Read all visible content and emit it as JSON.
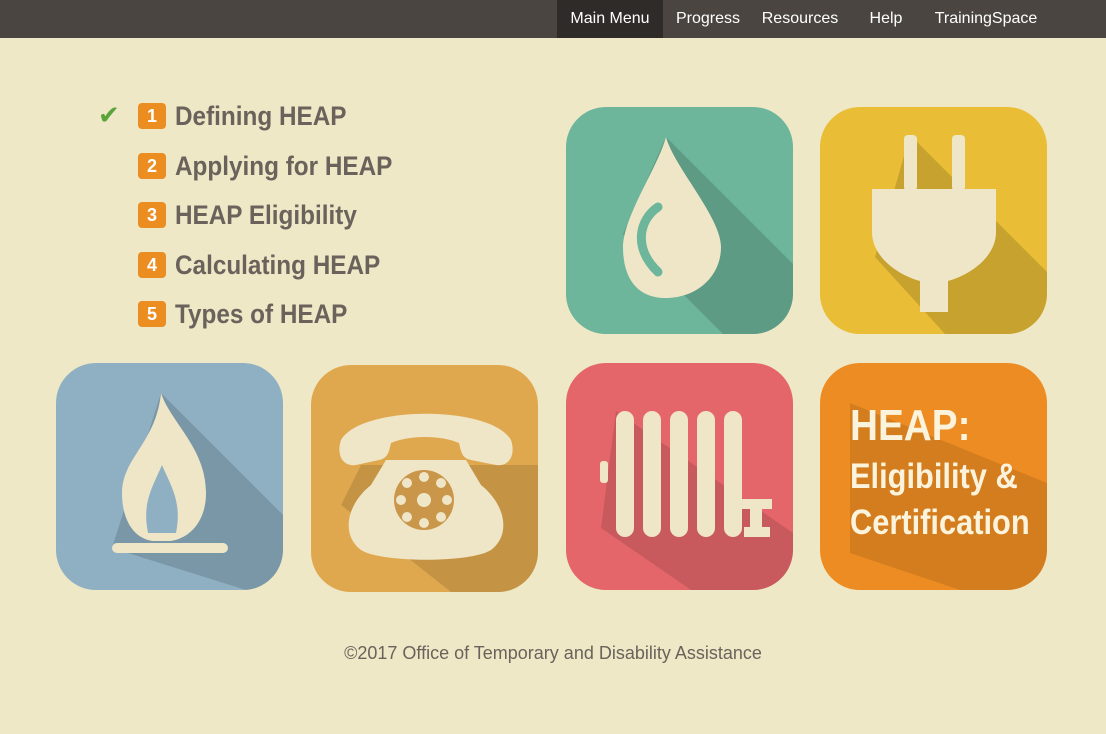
{
  "nav": {
    "items": [
      {
        "label": "Main Menu"
      },
      {
        "label": "Progress"
      },
      {
        "label": "Resources"
      },
      {
        "label": "Help"
      },
      {
        "label": "TrainingSpace"
      }
    ]
  },
  "menu": {
    "items": [
      {
        "number": "1",
        "label": "Defining HEAP",
        "completed": true
      },
      {
        "number": "2",
        "label": "Applying for HEAP",
        "completed": false
      },
      {
        "number": "3",
        "label": "HEAP Eligibility",
        "completed": false
      },
      {
        "number": "4",
        "label": "Calculating HEAP",
        "completed": false
      },
      {
        "number": "5",
        "label": "Types of HEAP",
        "completed": false
      }
    ],
    "check_glyph": "✔"
  },
  "tiles": [
    {
      "icon": "water-drop-icon",
      "color": "#6db59b"
    },
    {
      "icon": "electric-plug-icon",
      "color": "#e9bd36"
    },
    {
      "icon": "gas-flame-icon",
      "color": "#8fb0c3"
    },
    {
      "icon": "rotary-phone-icon",
      "color": "#e0a84e"
    },
    {
      "icon": "radiator-icon",
      "color": "#e4666a"
    }
  ],
  "title_tile": {
    "line1": "HEAP:",
    "line2": "Eligibility &",
    "line3": "Certification",
    "color": "#ec8c22"
  },
  "footer": {
    "text": "©2017 Office of Temporary and Disability Assistance"
  },
  "colors": {
    "background": "#efe8c6",
    "topbar": "#4a4540",
    "accent": "#ec8d22",
    "check": "#5aa43a",
    "menu_text": "#6b625c"
  }
}
